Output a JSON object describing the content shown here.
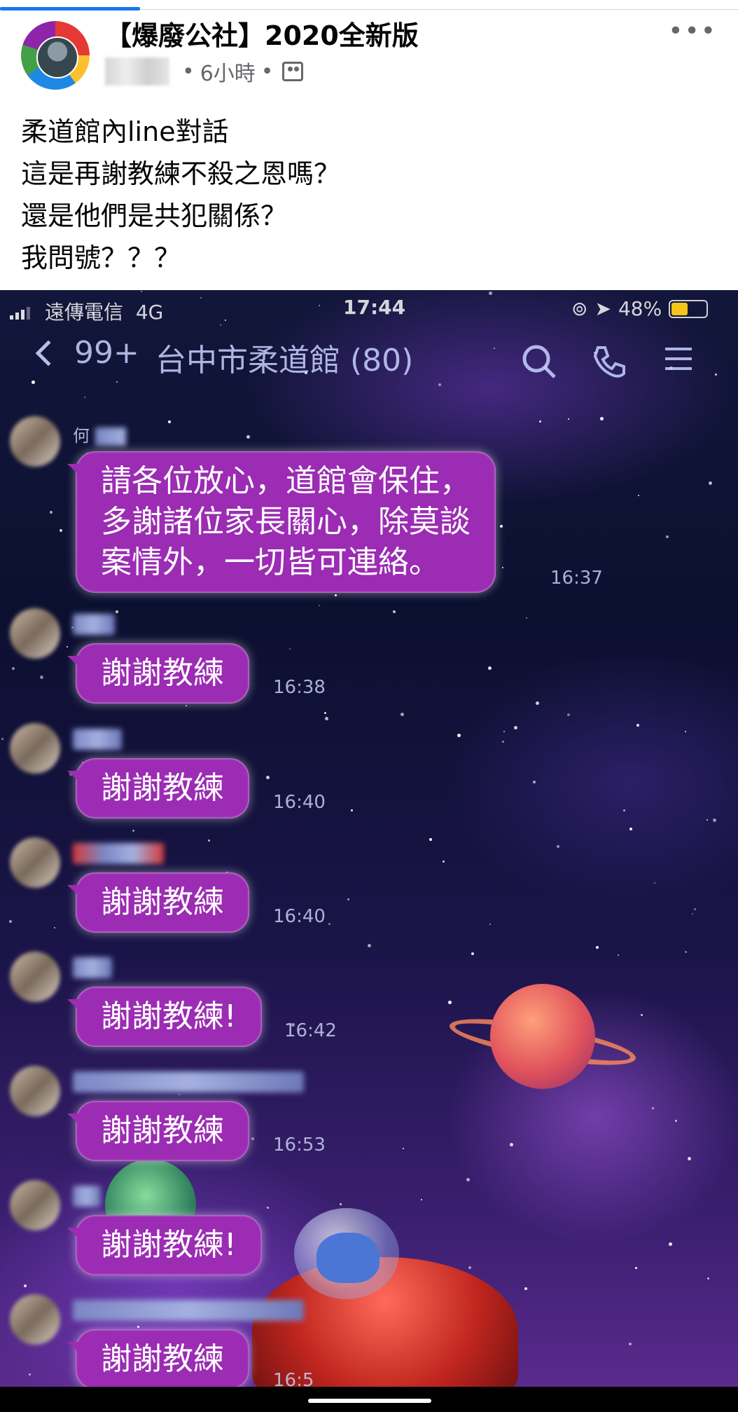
{
  "post": {
    "group_name": "【爆廢公社】2020全新版",
    "time_ago": "6小時",
    "separator": "•",
    "more_label": "•••",
    "text_lines": [
      "柔道館內line對話",
      "這是再謝教練不殺之恩嗎？",
      "還是他們是共犯關係？",
      "我問號？？？"
    ]
  },
  "screenshot": {
    "status": {
      "carrier": "遠傳電信",
      "network": "4G",
      "time": "17:44",
      "battery": "48%",
      "battery_level": 0.48
    },
    "chat": {
      "back_count": "99+",
      "room_title": "台中市柔道館 (80)"
    },
    "messages": [
      {
        "sender": "何",
        "lines": [
          "請各位放心，道館會保住，",
          "多謝諸位家長關心，除莫談",
          "案情外，一切皆可連絡。"
        ],
        "time": "16:37"
      },
      {
        "sender": "",
        "lines": [
          "謝謝教練"
        ],
        "time": "16:38"
      },
      {
        "sender": "",
        "lines": [
          "謝謝教練"
        ],
        "time": "16:40"
      },
      {
        "sender": "",
        "lines": [
          "謝謝教練"
        ],
        "time": "16:40"
      },
      {
        "sender": "",
        "lines": [
          "謝謝教練!"
        ],
        "time": "16:42"
      },
      {
        "sender": "",
        "lines": [
          "謝謝教練"
        ],
        "time": "16:53"
      },
      {
        "sender": "",
        "lines": [
          "謝謝教練!"
        ],
        "time": ""
      },
      {
        "sender": "",
        "lines": [
          "謝謝教練"
        ],
        "time": "16:5"
      }
    ]
  },
  "colors": {
    "bubble": "#9b2cb3",
    "fb_text": "#050505",
    "fb_meta": "#65676b",
    "fb_blue": "#1877f2"
  }
}
